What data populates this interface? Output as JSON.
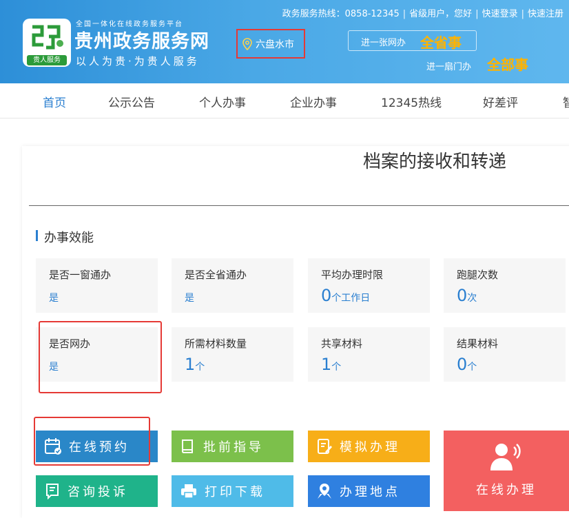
{
  "header": {
    "platform_line": "全国一体化在线政务服务平台",
    "site_name": "贵州政务服务网",
    "slogan": "以人为贵·为贵人服务",
    "logo_tag": "贵人服务",
    "location": "六盘水市",
    "hotline": "政务服务热线：0858-12345",
    "user_status": "省级用户，您好",
    "quick_login": "快速登录",
    "quick_register": "快速注册",
    "promo_line1_text": "进一张网办",
    "promo_line1_bold": "全省事",
    "promo_line2_text": "进一扇门办",
    "promo_line2_bold": "全部事"
  },
  "nav": {
    "items": [
      "首页",
      "公示公告",
      "个人办事",
      "企业办事",
      "12345热线",
      "好差评",
      "智"
    ],
    "active_index": 0
  },
  "page": {
    "title": "档案的接收和转递",
    "section_title": "办事效能"
  },
  "tiles": [
    {
      "label": "是否一窗通办",
      "value": "是"
    },
    {
      "label": "是否全省通办",
      "value": "是"
    },
    {
      "label": "平均办理时限",
      "number": "0",
      "unit": "个工作日"
    },
    {
      "label": "跑腿次数",
      "number": "0",
      "unit": "次"
    },
    {
      "label": "是否网办",
      "value": "是"
    },
    {
      "label": "所需材料数量",
      "number": "1",
      "unit": "个"
    },
    {
      "label": "共享材料",
      "number": "1",
      "unit": "个"
    },
    {
      "label": "结果材料",
      "number": "0",
      "unit": "个"
    }
  ],
  "actions": {
    "online_booking": "在线预约",
    "pre_approval_guide": "批前指导",
    "simulate_handling": "模拟办理",
    "consult_complaint": "咨询投诉",
    "print_download": "打印下载",
    "handling_location": "办理地点",
    "online_handling": "在线办理"
  },
  "colors": {
    "header_blue": "#2d8fd8",
    "accent_blue": "#2a7fd0",
    "highlight_red": "#e53935",
    "booking_blue": "#2a87c8",
    "guide_green": "#7cc04b",
    "simulate_orange": "#f7ae18",
    "consult_teal": "#1fb38a",
    "print_lightblue": "#4fbbe8",
    "location_blue": "#2f80e0",
    "online_red": "#f36060"
  }
}
